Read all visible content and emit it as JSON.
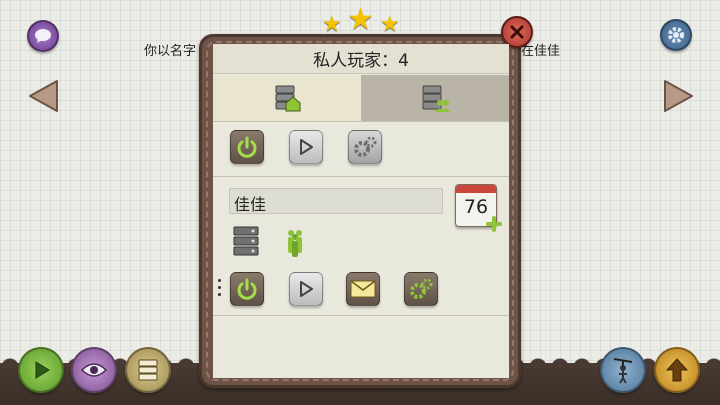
{
  "background": {
    "hint_left": "你以名字",
    "hint_right": "在佳佳"
  },
  "panel": {
    "title": "私人玩家：4",
    "tabs": [
      {
        "name": "home",
        "icon": "server-home-icon",
        "active": true
      },
      {
        "name": "group",
        "icon": "server-group-icon",
        "active": false
      }
    ],
    "player": {
      "name_value": "佳佳",
      "calendar_number": "76"
    }
  },
  "colors": {
    "accent_green": "#8fc33a",
    "close_red": "#c9463a",
    "star_gold": "#f4c200",
    "frame_brown": "#6e5346"
  }
}
